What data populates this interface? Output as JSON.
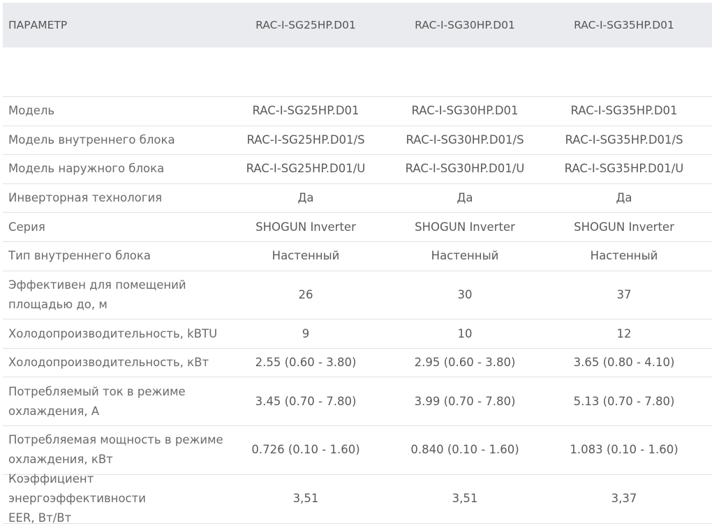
{
  "header": {
    "param_label": "ПАРАМЕТР",
    "models": [
      "RAC-I-SG25HP.D01",
      "RAC-I-SG30HP.D01",
      "RAC-I-SG35HP.D01"
    ]
  },
  "rows": [
    {
      "label": "Модель",
      "values": [
        "RAC-I-SG25HP.D01",
        "RAC-I-SG30HP.D01",
        "RAC-I-SG35HP.D01"
      ]
    },
    {
      "label": "Модель внутреннего блока",
      "values": [
        "RAC-I-SG25HP.D01/S",
        "RAC-I-SG30HP.D01/S",
        "RAC-I-SG35HP.D01/S"
      ]
    },
    {
      "label": "Модель наружного блока",
      "values": [
        "RAC-I-SG25HP.D01/U",
        "RAC-I-SG30HP.D01/U",
        "RAC-I-SG35HP.D01/U"
      ]
    },
    {
      "label": "Инверторная технология",
      "values": [
        "Да",
        "Да",
        "Да"
      ]
    },
    {
      "label": "Серия",
      "values": [
        "SHOGUN Inverter",
        "SHOGUN Inverter",
        "SHOGUN Inverter"
      ]
    },
    {
      "label": "Тип внутреннего блока",
      "values": [
        "Настенный",
        "Настенный",
        "Настенный"
      ]
    },
    {
      "label_lines": [
        "Эффективен для помещений",
        "площадью до, м"
      ],
      "values": [
        "26",
        "30",
        "37"
      ]
    },
    {
      "label": "Холодопроизводительность, kBTU",
      "values": [
        "9",
        "10",
        "12"
      ]
    },
    {
      "label": "Холодопроизводительность, кВт",
      "values": [
        "2.55 (0.60 - 3.80)",
        "2.95 (0.60 - 3.80)",
        "3.65 (0.80 - 4.10)"
      ]
    },
    {
      "label_lines": [
        "Потребляемый ток в режиме",
        "охлаждения, А"
      ],
      "values": [
        "3.45 (0.70 - 7.80)",
        "3.99 (0.70 - 7.80)",
        "5.13 (0.70 - 7.80)"
      ]
    },
    {
      "label_lines": [
        "Потребляемая мощность в режиме",
        "охлаждения, кВт"
      ],
      "values": [
        "0.726 (0.10 - 1.60)",
        "0.840 (0.10 - 1.60)",
        "1.083 (0.10 - 1.60)"
      ]
    },
    {
      "label_lines": [
        "Коэффициент энергоэффективности",
        "EER, Вт/Вт"
      ],
      "values": [
        "3,51",
        "3,51",
        "3,37"
      ]
    }
  ]
}
